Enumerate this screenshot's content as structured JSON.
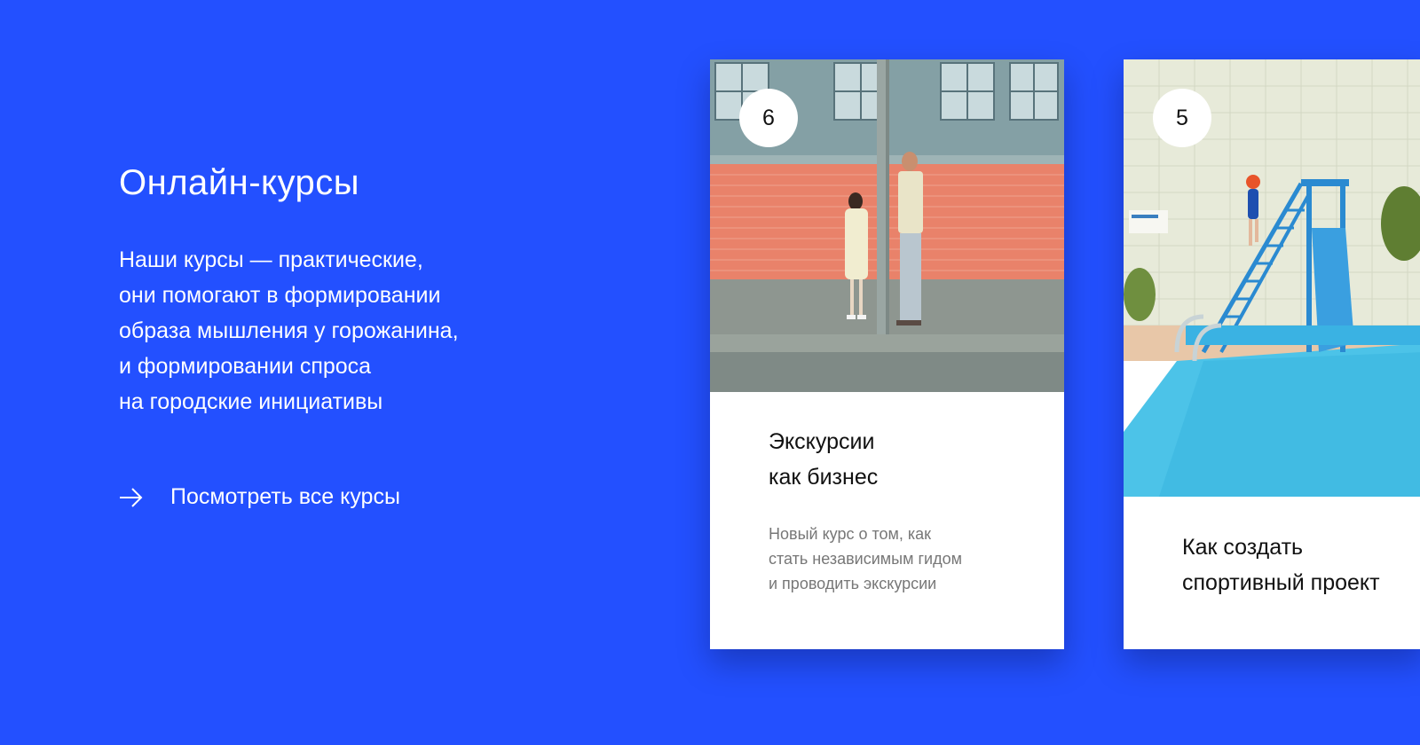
{
  "section": {
    "title": "Онлайн-курсы",
    "description_lines": [
      "Наши курсы — практические,",
      "они помогают в формировании",
      "образа мышления у горожанина,",
      "и формировании спроса",
      "на городские инициативы"
    ],
    "all_courses_link": "Посмотреть все курсы",
    "link_icon": "arrow-right-icon"
  },
  "cards": [
    {
      "number": "6",
      "title_lines": [
        "Экскурсии",
        "как бизнес"
      ],
      "description_lines": [
        "Новый курс о том, как",
        "стать независимым гидом",
        "и проводить экскурсии"
      ]
    },
    {
      "number": "5",
      "title_lines": [
        "Как создать",
        "спортивный проект"
      ]
    }
  ],
  "colors": {
    "background": "#2350ff",
    "card_background": "#ffffff",
    "card_text": "#111111",
    "card_muted_text": "#777777",
    "brick_wall": "#e9826a",
    "pool_water": "#4cc3e8"
  }
}
